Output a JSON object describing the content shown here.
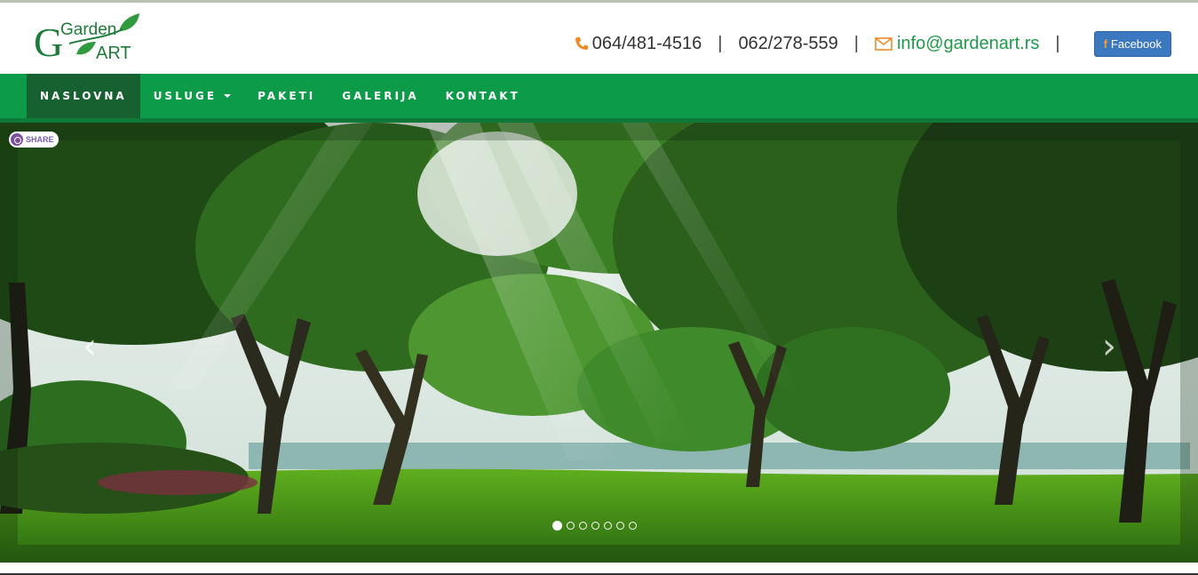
{
  "brand": {
    "logo_top": "Garden",
    "logo_bottom": "ART",
    "logo_letter": "G",
    "green": "#0b9b49",
    "dark_green": "#17602f"
  },
  "contacts": {
    "phone1": "064/481-4516",
    "separator": "|",
    "phone2": "062/278-559",
    "email": "info@gardenart.rs",
    "facebook_label": "Facebook",
    "phone_icon": "phone-icon",
    "mail_icon": "envelope-icon"
  },
  "nav": {
    "items": [
      {
        "label": "NASLOVNA",
        "active": true
      },
      {
        "label": "USLUGE",
        "dropdown": true
      },
      {
        "label": "PAKETI"
      },
      {
        "label": "GALERIJA"
      },
      {
        "label": "KONTAKT"
      }
    ]
  },
  "slider": {
    "share_label": "SHARE",
    "prev_symbol": "‹",
    "next_symbol": "›",
    "slide_count": 7,
    "active_slide": 1
  }
}
